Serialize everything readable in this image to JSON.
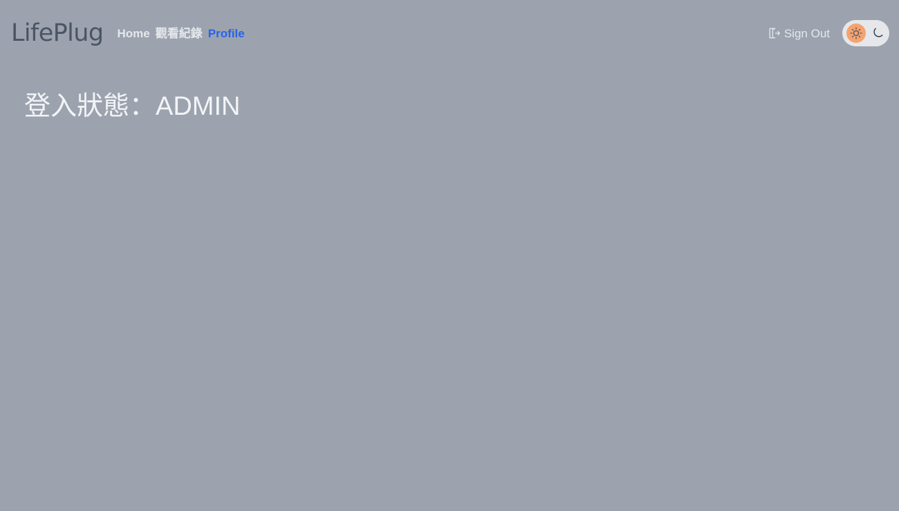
{
  "header": {
    "brand": "LifePlug",
    "nav": [
      {
        "label": "Home",
        "active": false
      },
      {
        "label": "觀看紀錄",
        "active": false
      },
      {
        "label": "Profile",
        "active": true
      }
    ],
    "sign_out_label": "Sign Out",
    "sign_out_icon": "sign-out-icon",
    "theme_toggle": {
      "selected": "light",
      "light_icon": "sun-icon",
      "dark_icon": "moon-icon"
    }
  },
  "main": {
    "login_status": "登入狀態：ADMIN"
  },
  "colors": {
    "background": "#9ca3af",
    "active_link": "#2563eb",
    "toggle_thumb": "#f5a36f"
  }
}
